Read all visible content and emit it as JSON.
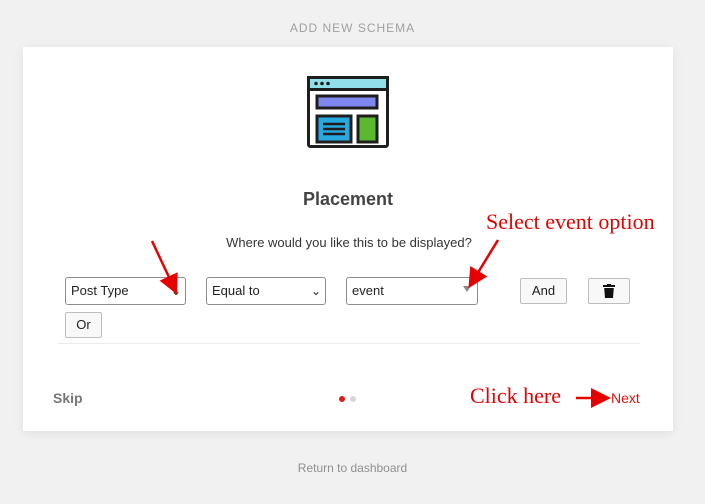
{
  "header": {
    "title": "ADD NEW SCHEMA"
  },
  "step": {
    "heading": "Placement",
    "question": "Where would you like this to be displayed?"
  },
  "rule": {
    "field_select": {
      "value": "Post Type"
    },
    "operator_select": {
      "value": "Equal to"
    },
    "value_select": {
      "value": "event"
    },
    "and_label": "And",
    "or_label": "Or",
    "delete_icon": "trash-icon"
  },
  "nav": {
    "skip_label": "Skip",
    "next_label": "Next",
    "pagination": {
      "total": 2,
      "active": 1
    },
    "active_dot_color": "#e21a1a",
    "inactive_dot_color": "#d6d6d6"
  },
  "footer": {
    "return_link": "Return to dashboard"
  },
  "annotations": {
    "select_event_text": "Select event option",
    "click_here_text": "Click here",
    "color": "#e60000"
  }
}
